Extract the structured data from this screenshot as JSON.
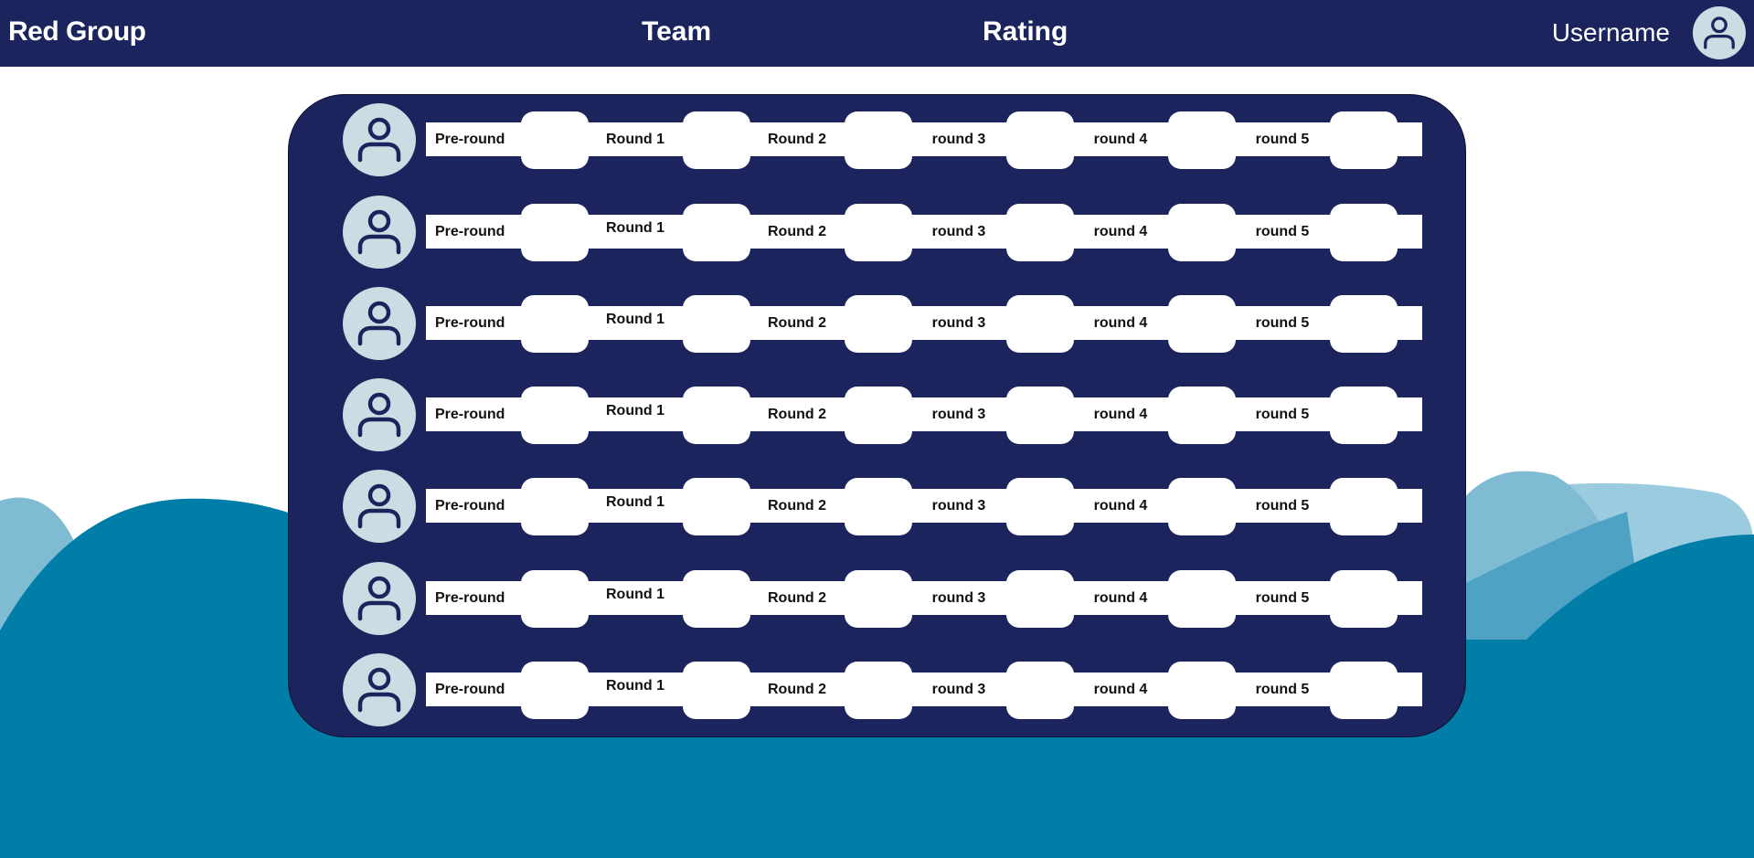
{
  "header": {
    "brand": "Red Group",
    "nav": [
      {
        "label": "Team"
      },
      {
        "label": "Rating"
      }
    ],
    "username": "Username",
    "avatar_icon": "user-icon"
  },
  "colors": {
    "navy": "#1b245c",
    "avatar_bg": "#c9dde2",
    "wave_dark": "#017ea8",
    "wave_mid": "#4ea2c3",
    "wave_light": "#7fbcd4",
    "wave_pale": "#9bcbdf"
  },
  "rows": [
    {
      "avatar_icon": "user-icon",
      "labels": [
        "Pre-round",
        "Round 1",
        "Round 2",
        "round 3",
        "round 4",
        "round 5"
      ]
    },
    {
      "avatar_icon": "user-icon",
      "labels": [
        "Pre-round",
        "Round 1",
        "Round 2",
        "round 3",
        "round 4",
        "round 5"
      ]
    },
    {
      "avatar_icon": "user-icon",
      "labels": [
        "Pre-round",
        "Round 1",
        "Round 2",
        "round 3",
        "round 4",
        "round 5"
      ]
    },
    {
      "avatar_icon": "user-icon",
      "labels": [
        "Pre-round",
        "Round 1",
        "Round 2",
        "round 3",
        "round 4",
        "round 5"
      ]
    },
    {
      "avatar_icon": "user-icon",
      "labels": [
        "Pre-round",
        "Round 1",
        "Round 2",
        "round 3",
        "round 4",
        "round 5"
      ]
    },
    {
      "avatar_icon": "user-icon",
      "labels": [
        "Pre-round",
        "Round 1",
        "Round 2",
        "round 3",
        "round 4",
        "round 5"
      ]
    },
    {
      "avatar_icon": "user-icon",
      "labels": [
        "Pre-round",
        "Round 1",
        "Round 2",
        "round 3",
        "round 4",
        "round 5"
      ]
    }
  ]
}
